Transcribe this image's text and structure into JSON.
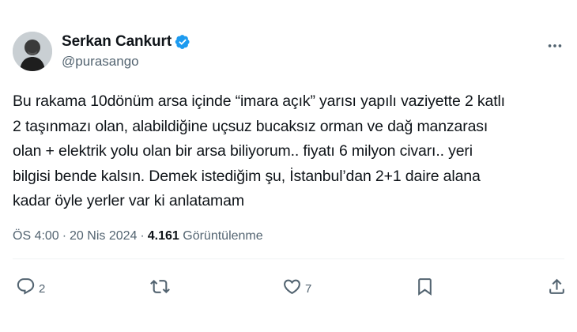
{
  "author": {
    "display_name": "Serkan Cankurt",
    "handle": "@purasango",
    "verified": true
  },
  "tweet": {
    "lines": [
      "Bu rakama 10dönüm arsa içinde “imara açık” yarısı yapılı vaziyette 2 katlı",
      "2 taşınmazı olan, alabildiğine uçsuz bucaksız orman ve dağ manzarası",
      "olan + elektrik yolu olan bir arsa biliyorum.. fiyatı 6 milyon civarı.. yeri",
      "bilgisi bende kalsın. Demek istediğim şu, İstanbul’dan 2+1 daire alana",
      "kadar öyle yerler var ki anlatamam"
    ]
  },
  "meta": {
    "time": "ÖS 4:00",
    "separator": "·",
    "date": "20 Nis 2024",
    "views_count": "4.161",
    "views_label": "Görüntülenme"
  },
  "actions": {
    "reply_count": "2",
    "retweet_count": "",
    "like_count": "7"
  },
  "colors": {
    "text": "#0f1419",
    "secondary": "#536471",
    "verified": "#1d9bf0",
    "divider": "#eff3f4"
  },
  "icons": [
    "verified-badge-icon",
    "more-icon",
    "reply-icon",
    "retweet-icon",
    "like-icon",
    "bookmark-icon",
    "share-icon"
  ]
}
